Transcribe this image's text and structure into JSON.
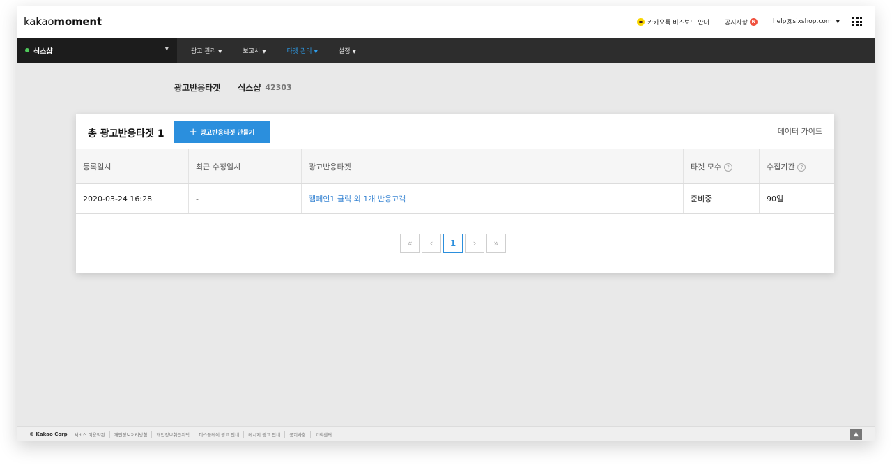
{
  "header": {
    "logo_light": "kakao",
    "logo_bold": "moment",
    "kakaotalk_link": "카카오톡 비즈보드 안내",
    "notice_link": "공지사항",
    "notice_badge": "N",
    "user_email": "help@sixshop.com"
  },
  "nav": {
    "account_name": "식스샵",
    "menu": [
      {
        "label": "광고 관리"
      },
      {
        "label": "보고서"
      },
      {
        "label": "타겟 관리"
      },
      {
        "label": "설정"
      }
    ],
    "active_index": 2
  },
  "page": {
    "title": "광고반응타겟",
    "account_name": "식스샵",
    "account_id": "42303"
  },
  "card": {
    "total_label": "총 광고반응타겟 1",
    "create_button": "광고반응타겟 만들기",
    "guide_link": "데이터 가이드"
  },
  "table": {
    "headers": [
      "등록일시",
      "최근 수정일시",
      "광고반응타겟",
      "타겟 모수",
      "수집기간"
    ],
    "rows": [
      {
        "registered": "2020-03-24 16:28",
        "modified": "-",
        "target": "캠페인1 클릭 외 1개 반응고객",
        "population": "준비중",
        "period": "90일"
      }
    ]
  },
  "pagination": {
    "first": "«",
    "prev": "‹",
    "current": "1",
    "next": "›",
    "last": "»"
  },
  "footer": {
    "copyright": "© Kakao Corp",
    "links": [
      "서비스 이용약관",
      "개인정보처리방침",
      "개인정보취급위탁",
      "디스플레이 광고 안내",
      "메시지 광고 안내",
      "공지사항",
      "고객센터"
    ]
  },
  "colors": {
    "accent": "#2b8fdd",
    "status_ready": "#5fae3b",
    "nav_bg": "#2d2d2d",
    "active_menu": "#2e9dea"
  }
}
